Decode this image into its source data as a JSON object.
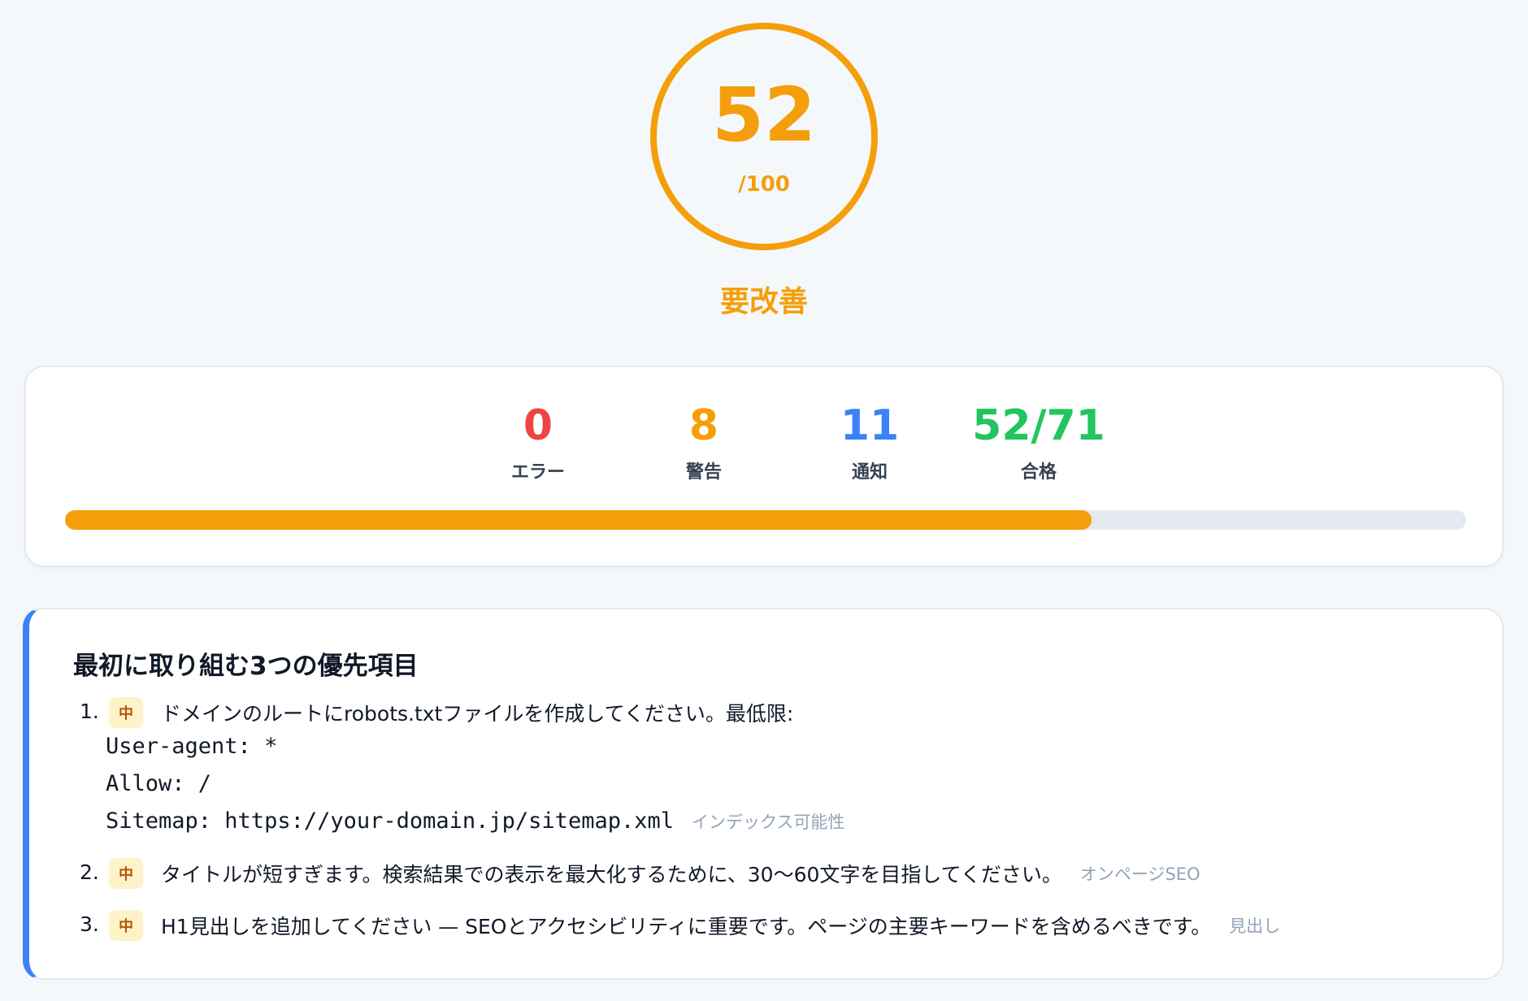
{
  "score": {
    "value": "52",
    "max": "/100",
    "progress": 0.52,
    "label": "要改善"
  },
  "stats": {
    "items": [
      {
        "value": "0",
        "label": "エラー",
        "color": "#ef4444"
      },
      {
        "value": "8",
        "label": "警告",
        "color": "#f59e0b"
      },
      {
        "value": "11",
        "label": "通知",
        "color": "#3b82f6"
      },
      {
        "value": "52/71",
        "label": "合格",
        "color": "#22c55e"
      }
    ],
    "pass_ratio": 0.7324
  },
  "priorities": {
    "title": "最初に取り組む3つの優先項目",
    "items": [
      {
        "num": "1.",
        "badge": "中",
        "text": "ドメインのルートにrobots.txtファイルを作成してください。最低限:",
        "code": [
          "User-agent: *",
          "Allow: /",
          "Sitemap: https://your-domain.jp/sitemap.xml"
        ],
        "category": "インデックス可能性"
      },
      {
        "num": "2.",
        "badge": "中",
        "text": "タイトルが短すぎます。検索結果での表示を最大化するために、30〜60文字を目指してください。",
        "category": "オンページSEO"
      },
      {
        "num": "3.",
        "badge": "中",
        "text": "H1見出しを追加してください — SEOとアクセシビリティに重要です。ページの主要キーワードを含めるべきです。",
        "category": "見出し"
      }
    ]
  }
}
